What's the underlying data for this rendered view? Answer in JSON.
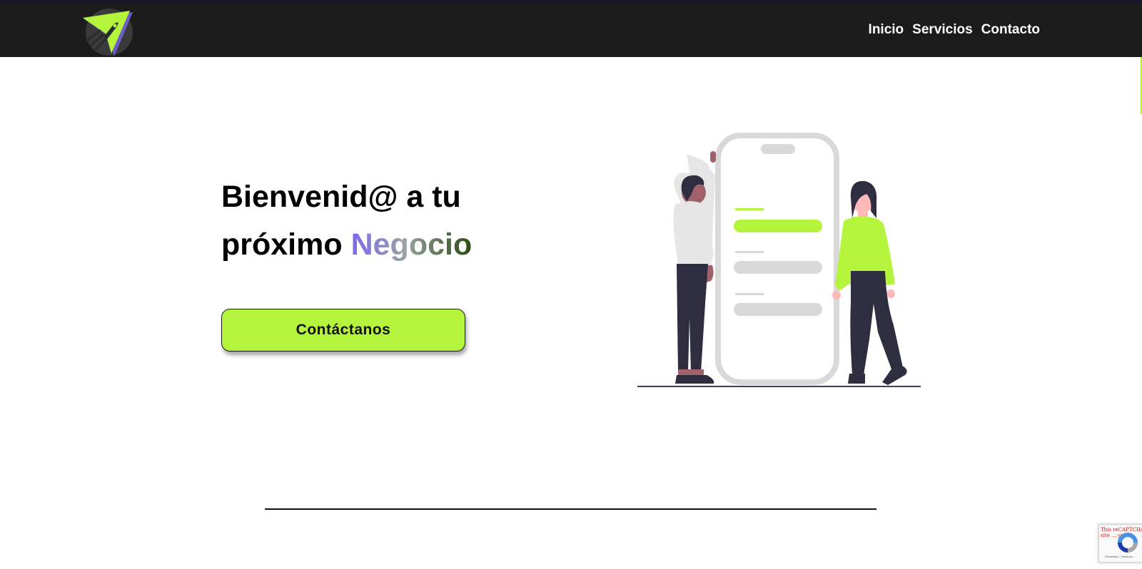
{
  "header": {
    "logo_icon": "rocket-paper-plane-icon",
    "nav": [
      {
        "label": "Inicio"
      },
      {
        "label": "Servicios"
      },
      {
        "label": "Contacto"
      }
    ]
  },
  "hero": {
    "title_line1": "Bienvenid@ a tu",
    "title_line2_prefix": "próximo",
    "title_highlight": "Negocio",
    "cta_label": "Contáctanos",
    "illustration_icon": "people-smartphone-illustration"
  },
  "recaptcha": {
    "message": "This reCAPTCHA site ... you ...",
    "links": "Privacidad - Términos",
    "icon": "recaptcha-icon"
  },
  "colors": {
    "navbar_bg": "#1b1b1b",
    "accent_green": "#b4f43c",
    "gradient_start": "#7d68f0",
    "gradient_end": "#2b4a12"
  }
}
